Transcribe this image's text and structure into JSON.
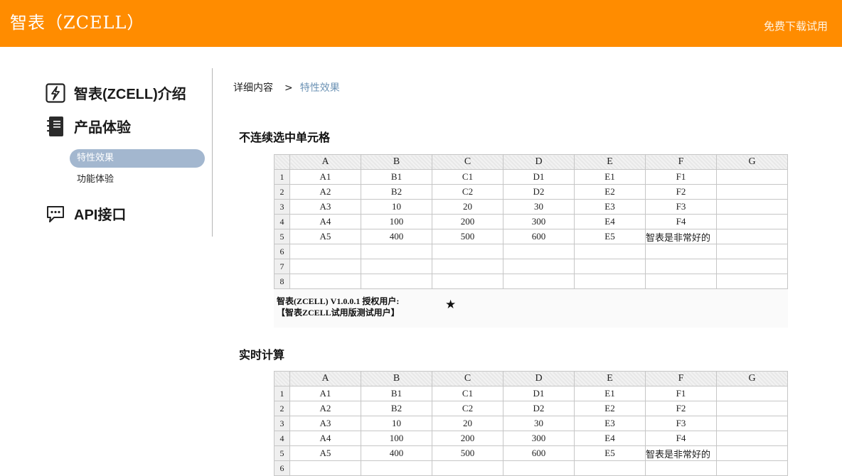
{
  "header": {
    "brand": "智表（ZCELL）",
    "download_label": "免费下载试用",
    "brand_color": "#ff8c00"
  },
  "sidebar": {
    "items": [
      {
        "label": "智表(ZCELL)介绍",
        "icon": "lightning-icon"
      },
      {
        "label": "产品体验",
        "icon": "notebook-icon"
      },
      {
        "label": "API接口",
        "icon": "chat-bubble-icon"
      }
    ],
    "sub_items": [
      {
        "label": "特性效果",
        "active": true
      },
      {
        "label": "功能体验",
        "active": false
      }
    ],
    "active_color": "#a3b7cf"
  },
  "breadcrumb": {
    "parent": "详细内容",
    "separator": ">",
    "current": "特性效果"
  },
  "sections": [
    {
      "title": "不连续选中单元格",
      "columns": [
        "A",
        "B",
        "C",
        "D",
        "E",
        "F",
        "G"
      ],
      "rows": [
        [
          "1",
          "A1",
          "B1",
          "C1",
          "D1",
          "E1",
          "F1",
          ""
        ],
        [
          "2",
          "A2",
          "B2",
          "C2",
          "D2",
          "E2",
          "F2",
          ""
        ],
        [
          "3",
          "A3",
          "10",
          "20",
          "30",
          "E3",
          "F3",
          ""
        ],
        [
          "4",
          "A4",
          "100",
          "200",
          "300",
          "E4",
          "F4",
          ""
        ],
        [
          "5",
          "A5",
          "400",
          "500",
          "600",
          "E5",
          "智表是非常好的",
          ""
        ],
        [
          "6",
          "",
          "",
          "",
          "",
          "",
          "",
          ""
        ],
        [
          "7",
          "",
          "",
          "",
          "",
          "",
          "",
          ""
        ],
        [
          "8",
          "",
          "",
          "",
          "",
          "",
          "",
          ""
        ]
      ],
      "footer": {
        "version": "智表(ZCELL)  V1.0.0.1    授权用户:",
        "user": "【智表ZCELL试用版测试用户】",
        "star": "★"
      }
    },
    {
      "title": "实时计算",
      "columns": [
        "A",
        "B",
        "C",
        "D",
        "E",
        "F",
        "G"
      ],
      "rows": [
        [
          "1",
          "A1",
          "B1",
          "C1",
          "D1",
          "E1",
          "F1",
          ""
        ],
        [
          "2",
          "A2",
          "B2",
          "C2",
          "D2",
          "E2",
          "F2",
          ""
        ],
        [
          "3",
          "A3",
          "10",
          "20",
          "30",
          "E3",
          "F3",
          ""
        ],
        [
          "4",
          "A4",
          "100",
          "200",
          "300",
          "E4",
          "F4",
          ""
        ],
        [
          "5",
          "A5",
          "400",
          "500",
          "600",
          "E5",
          "智表是非常好的",
          ""
        ],
        [
          "6",
          "",
          "",
          "",
          "",
          "",
          "",
          ""
        ]
      ]
    }
  ]
}
